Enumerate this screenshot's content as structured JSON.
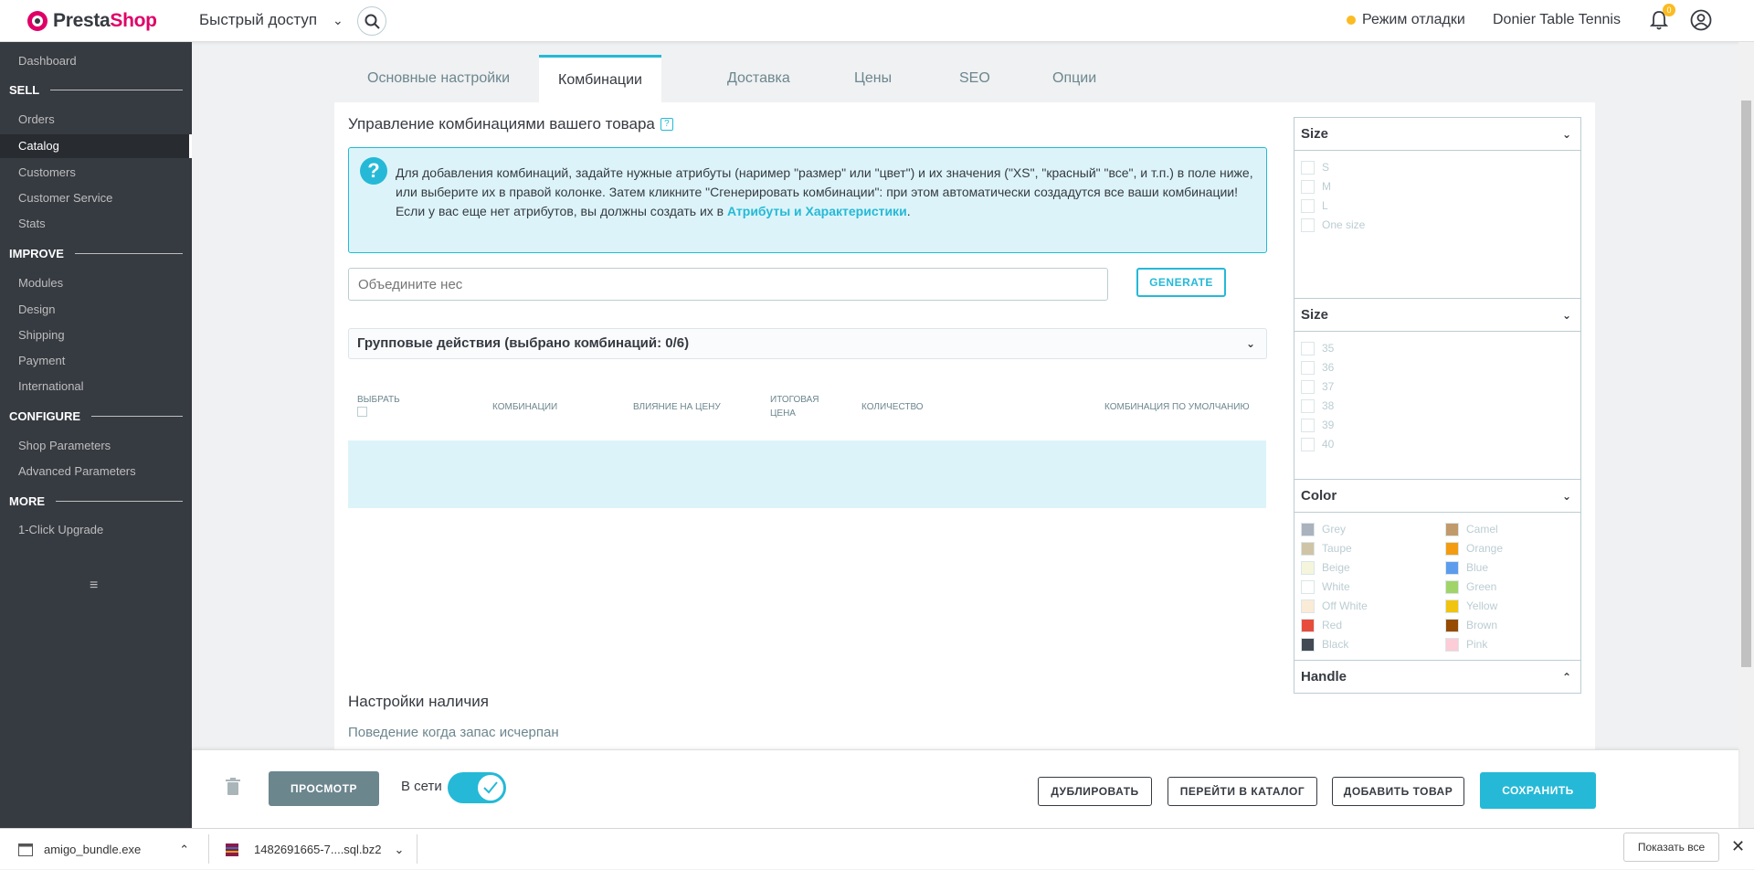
{
  "header": {
    "logo_part1": "Presta",
    "logo_part2": "Shop",
    "quick_access": "Быстрый доступ",
    "debug_mode": "Режим отладки",
    "shop_name": "Donier Table Tennis",
    "notification_count": "0"
  },
  "sidebar": {
    "items": [
      {
        "label": "Dashboard"
      },
      {
        "label": "Orders"
      },
      {
        "label": "Catalog"
      },
      {
        "label": "Customers"
      },
      {
        "label": "Customer Service"
      },
      {
        "label": "Stats"
      },
      {
        "label": "Modules"
      },
      {
        "label": "Design"
      },
      {
        "label": "Shipping"
      },
      {
        "label": "Payment"
      },
      {
        "label": "International"
      },
      {
        "label": "Shop Parameters"
      },
      {
        "label": "Advanced Parameters"
      },
      {
        "label": "1-Click Upgrade"
      }
    ],
    "sections": [
      "SELL",
      "IMPROVE",
      "CONFIGURE",
      "MORE"
    ],
    "active": "Catalog"
  },
  "tabs": [
    {
      "label": "Основные настройки"
    },
    {
      "label": "Комбинации"
    },
    {
      "label": "Доставка"
    },
    {
      "label": "Цены"
    },
    {
      "label": "SEO"
    },
    {
      "label": "Опции"
    }
  ],
  "main": {
    "title": "Управление комбинациями вашего товара",
    "help_glyph": "?",
    "info_line1": "Для добавления комбинаций, задайте нужные атрибуты (наример \"размер\" или \"цвет\") и их значения (\"XS\", \"красный\" \"все\", и т.п.) в поле ниже, или выберите их в правой колонке. Затем кликните \"Сгенерировать комбинации\": при этом автоматически создадутся все ваши комбинации!",
    "info_line2_prefix": "Если у вас еще нет атрибутов, вы должны создать их в ",
    "info_link": "Атрибуты и Характеристики",
    "info_line2_suffix": ".",
    "combine_placeholder": "Объедините нес",
    "generate_label": "GENERATE",
    "bulk_actions": "Групповые действия (выбрано комбинаций: 0/6)",
    "table_headers": {
      "select": "ВЫБРАТЬ",
      "combinations": "КОМБИНАЦИИ",
      "price_impact": "ВЛИЯНИЕ НА ЦЕНУ",
      "final_price_1": "ИТОГОВАЯ",
      "final_price_2": "ЦЕНА",
      "quantity": "КОЛИЧЕСТВО",
      "default": "КОМБИНАЦИЯ ПО УМОЛЧАНИЮ"
    },
    "stock_title": "Настройки наличия",
    "stock_subtitle": "Поведение когда запас исчерпан"
  },
  "filters": {
    "size1": {
      "title": "Size",
      "options": [
        "S",
        "M",
        "L",
        "One size"
      ]
    },
    "size2": {
      "title": "Size",
      "options": [
        "35",
        "36",
        "37",
        "38",
        "39",
        "40"
      ]
    },
    "color": {
      "title": "Color",
      "options": [
        {
          "name": "Grey",
          "hex": "#aab2bd"
        },
        {
          "name": "Taupe",
          "hex": "#cfc4a6"
        },
        {
          "name": "Beige",
          "hex": "#f5f5dc"
        },
        {
          "name": "White",
          "hex": "#ffffff"
        },
        {
          "name": "Off White",
          "hex": "#faebd7"
        },
        {
          "name": "Red",
          "hex": "#e84c3d"
        },
        {
          "name": "Black",
          "hex": "#434a54"
        },
        {
          "name": "Camel",
          "hex": "#c19a6b"
        },
        {
          "name": "Orange",
          "hex": "#f39c11"
        },
        {
          "name": "Blue",
          "hex": "#5d9cec"
        },
        {
          "name": "Green",
          "hex": "#a0d468"
        },
        {
          "name": "Yellow",
          "hex": "#f1c40f"
        },
        {
          "name": "Brown",
          "hex": "#964b00"
        },
        {
          "name": "Pink",
          "hex": "#fcccd7"
        }
      ]
    },
    "handle": {
      "title": "Handle"
    }
  },
  "footer": {
    "preview": "ПРОСМОТР",
    "online_label": "В сети",
    "online": true,
    "duplicate": "ДУБЛИРОВАТЬ",
    "go_catalog": "ПЕРЕЙТИ В КАТАЛОГ",
    "add_product": "ДОБАВИТЬ ТОВАР",
    "save": "СОХРАНИТЬ"
  },
  "downloads": {
    "items": [
      {
        "name": "amigo_bundle.exe"
      },
      {
        "name": "1482691665-7....sql.bz2"
      }
    ],
    "show_all": "Показать все"
  },
  "colors": {
    "accent": "#25b9d7",
    "sidebar_bg": "#363a41",
    "brand": "#df0067"
  }
}
